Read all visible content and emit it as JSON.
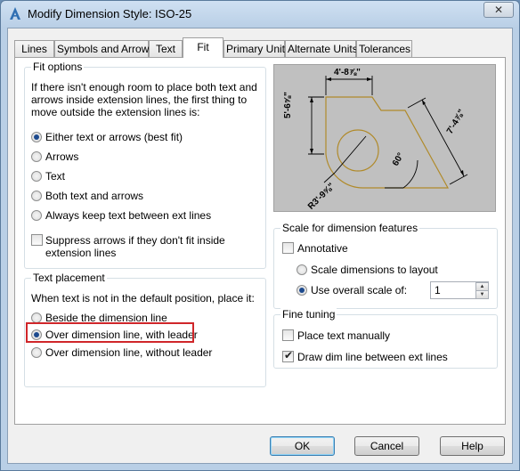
{
  "window": {
    "title": "Modify Dimension Style: ISO-25",
    "close": "✕"
  },
  "tabs": [
    "Lines",
    "Symbols and Arrows",
    "Text",
    "Fit",
    "Primary Units",
    "Alternate Units",
    "Tolerances"
  ],
  "fit_options": {
    "label": "Fit options",
    "description": [
      "If there isn't enough room to place both text and",
      "arrows inside extension lines, the first thing to",
      "move outside the extension lines is:"
    ],
    "options": [
      "Either text or arrows (best fit)",
      "Arrows",
      "Text",
      "Both text and arrows",
      "Always keep text between ext lines"
    ],
    "selected": 0,
    "suppress_label": [
      "Suppress arrows if they don't fit inside",
      "extension lines"
    ]
  },
  "text_placement": {
    "label": "Text placement",
    "description": "When text is not in the default position, place it:",
    "options": [
      "Beside the dimension line",
      "Over dimension line, with leader",
      "Over dimension line, without leader"
    ],
    "selected": 1
  },
  "preview": {
    "dim_top": "4'-8⅞\"",
    "dim_left": "5'-6⅝\"",
    "dim_right": "7'-4⅞\"",
    "dim_radius": "R3'-9⅝\"",
    "dim_angle": "60°"
  },
  "scale": {
    "label": "Scale for dimension features",
    "annotative": "Annotative",
    "scale_layout": "Scale dimensions to layout",
    "use_overall": "Use overall scale of:",
    "overall_value": "1"
  },
  "fine_tuning": {
    "label": "Fine tuning",
    "place_manually": "Place text manually",
    "draw_dim_line": "Draw dim line between ext lines"
  },
  "buttons": {
    "ok": "OK",
    "cancel": "Cancel",
    "help": "Help"
  }
}
